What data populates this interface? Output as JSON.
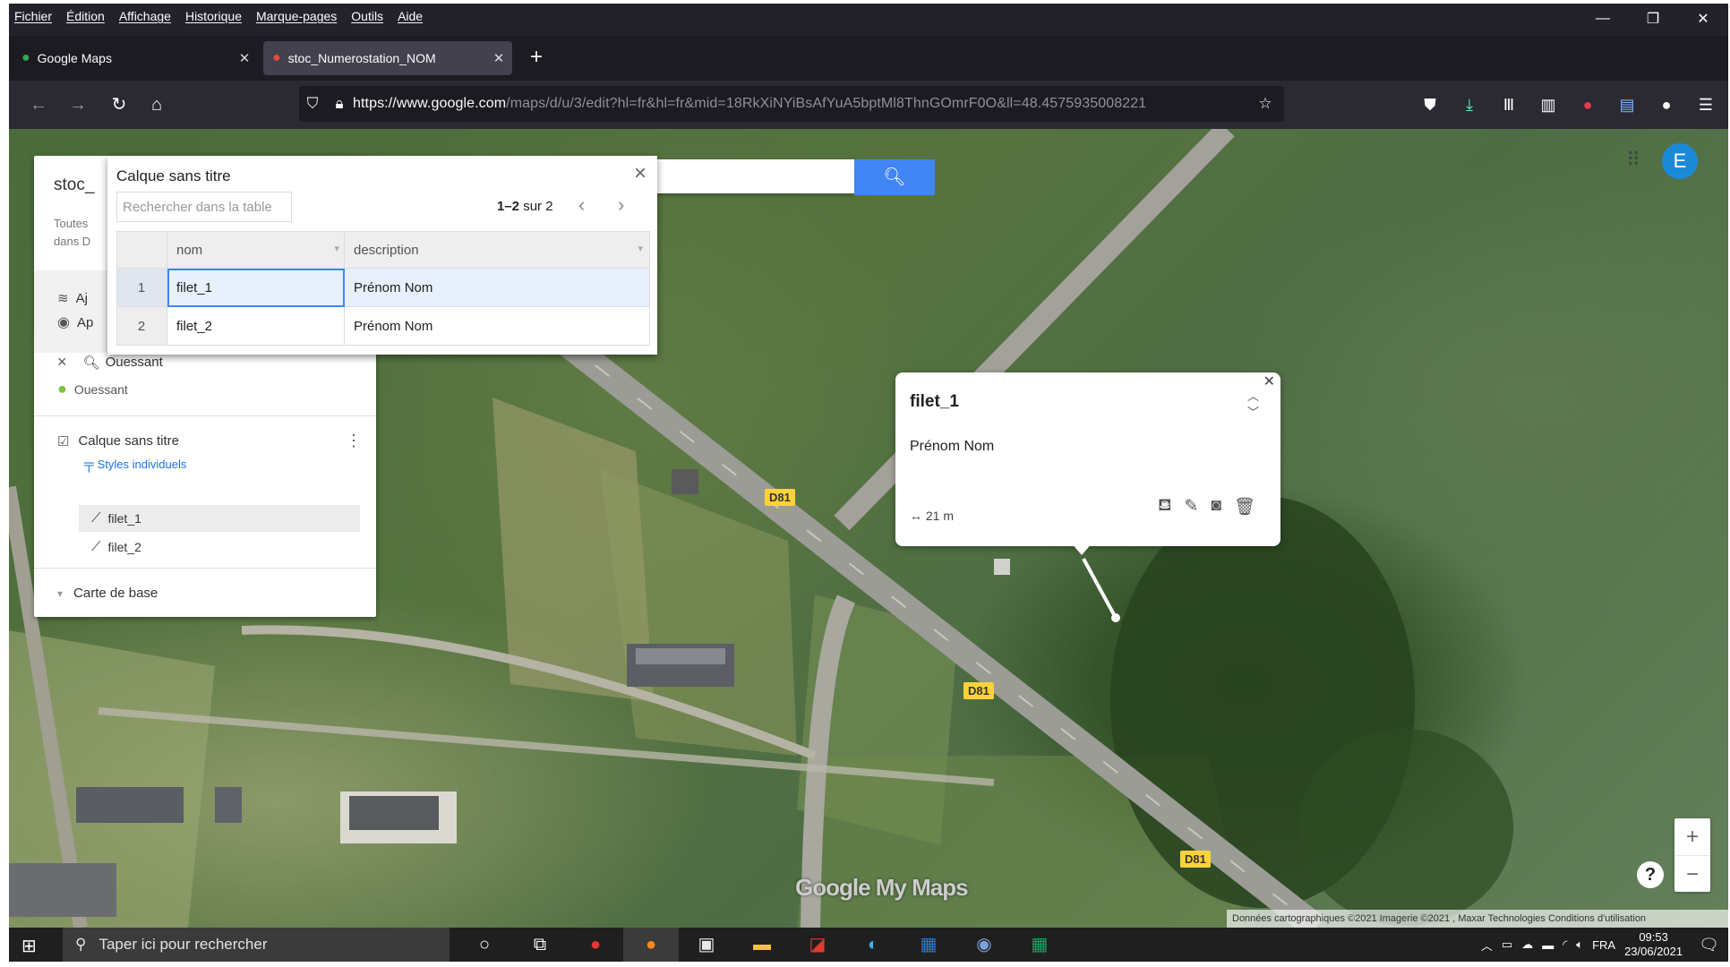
{
  "menu": [
    "Fichier",
    "Édition",
    "Affichage",
    "Historique",
    "Marque-pages",
    "Outils",
    "Aide"
  ],
  "tabs": [
    {
      "title": "Google Maps"
    },
    {
      "title": "stoc_Numerostation_NOM"
    }
  ],
  "url": {
    "host": "https://www.google.com",
    "path": "/maps/d/u/3/edit?hl=fr&hl=fr&mid=18RkXiNYiBsAfYuA5bptMl8ThnGOmrF0O&ll=48.4575935008221"
  },
  "left_panel": {
    "title": "stoc_",
    "subtitle_line1": "Toutes",
    "subtitle_line2": "dans D",
    "action1": "Aj",
    "action2": "Ap",
    "search_close": "×",
    "search_layer": "Ouessant",
    "place_result": "Ouessant",
    "layer_title": "Calque sans titre",
    "styles_link": "Styles individuels",
    "features": [
      "filet_1",
      "filet_2"
    ],
    "base_map": "Carte de base"
  },
  "dialog": {
    "title": "Calque sans titre",
    "search_placeholder": "Rechercher dans la table",
    "count_range": "1–2",
    "count_total": "sur 2",
    "columns": [
      "nom",
      "description"
    ],
    "rows": [
      {
        "n": "1",
        "nom": "filet_1",
        "description": "Prénom Nom"
      },
      {
        "n": "2",
        "nom": "filet_2",
        "description": "Prénom Nom"
      }
    ]
  },
  "avatar_letter": "E",
  "info_window": {
    "title": "filet_1",
    "description": "Prénom Nom",
    "length": "21 m"
  },
  "road_labels": [
    "D81",
    "D81",
    "D81"
  ],
  "brand_text": "Google My Maps",
  "attribution": "Données cartographiques ©2021 Imagerie ©2021 , Maxar Technologies    Conditions d'utilisation",
  "taskbar": {
    "search_placeholder": "Taper ici pour rechercher",
    "lang": "FRA",
    "time": "09:53",
    "date": "23/06/2021"
  }
}
